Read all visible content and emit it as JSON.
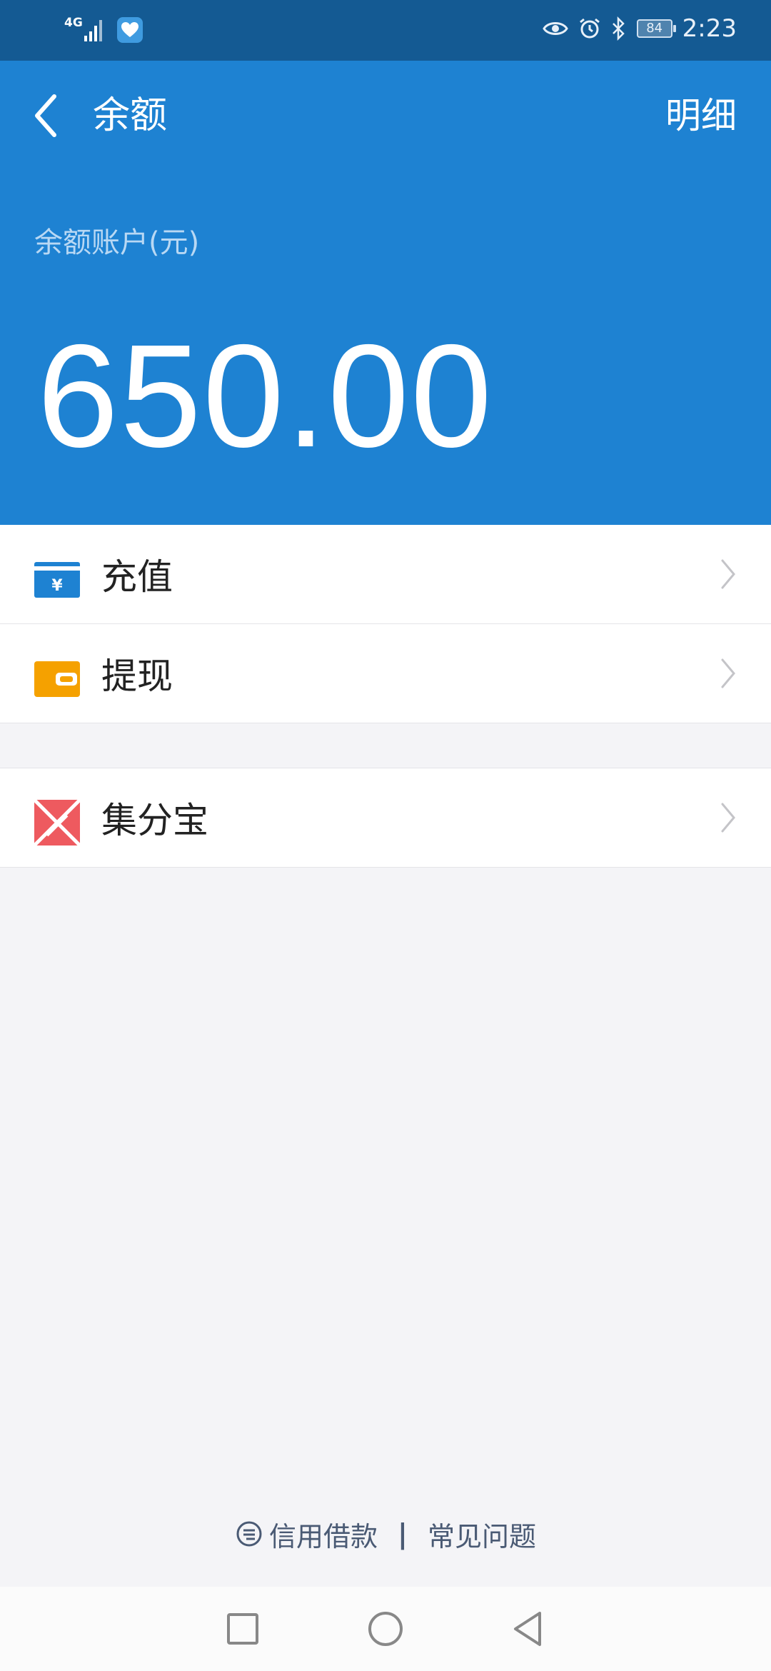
{
  "status_bar": {
    "network": "4G",
    "battery": "84",
    "time": "2:23"
  },
  "header": {
    "title": "余额",
    "detail_link": "明细",
    "account_label": "余额账户(元)",
    "amount": "650.00"
  },
  "menu": {
    "group1": [
      {
        "label": "充值",
        "icon": "recharge-card-icon"
      },
      {
        "label": "提现",
        "icon": "wallet-icon"
      }
    ],
    "group2": [
      {
        "label": "集分宝",
        "icon": "jifenbao-icon"
      }
    ]
  },
  "footer": {
    "credit_loan": "信用借款",
    "separator": "|",
    "faq": "常见问题"
  },
  "colors": {
    "status_bar": "#145a93",
    "header": "#1e82d2",
    "recharge_icon": "#1e82d2",
    "wallet_icon": "#f5a100",
    "jifenbao_icon": "#ee5a5f",
    "background": "#f4f4f7"
  }
}
